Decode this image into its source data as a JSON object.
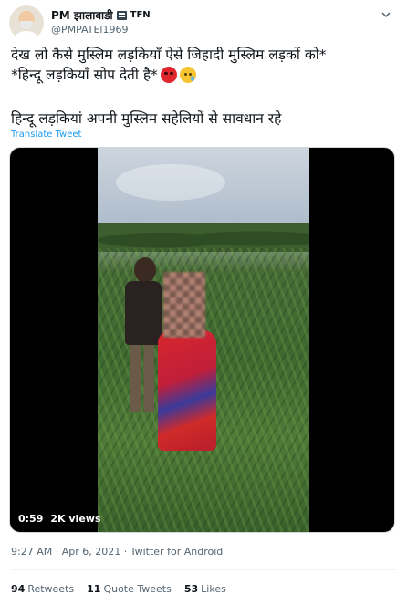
{
  "author": {
    "display_name": "PM झालावाडी",
    "badge_text": "TFN",
    "handle": "@PMPATEl1969"
  },
  "tweet": {
    "line1": "देख लो कैसे मुस्लिम लड़कियाँ ऐसे जिहादी मुस्लिम लड़कों को*",
    "line2": "*हिन्दू लड़कियाँ सोप देती है*",
    "line3": "हिन्दू लड़कियां  अपनी मुस्लिम सहेलियों से सावधान रहे",
    "translate_label": "Translate Tweet",
    "emojis": [
      "angry-face-icon",
      "crying-face-icon"
    ]
  },
  "video": {
    "duration": "0:59",
    "views": "2K views"
  },
  "meta": {
    "time": "9:27 AM",
    "date": "Apr 6, 2021",
    "source": "Twitter for Android",
    "separator": " · "
  },
  "stats": {
    "retweets_count": "94",
    "retweets_label": "Retweets",
    "quotes_count": "11",
    "quotes_label": "Quote Tweets",
    "likes_count": "53",
    "likes_label": "Likes"
  }
}
